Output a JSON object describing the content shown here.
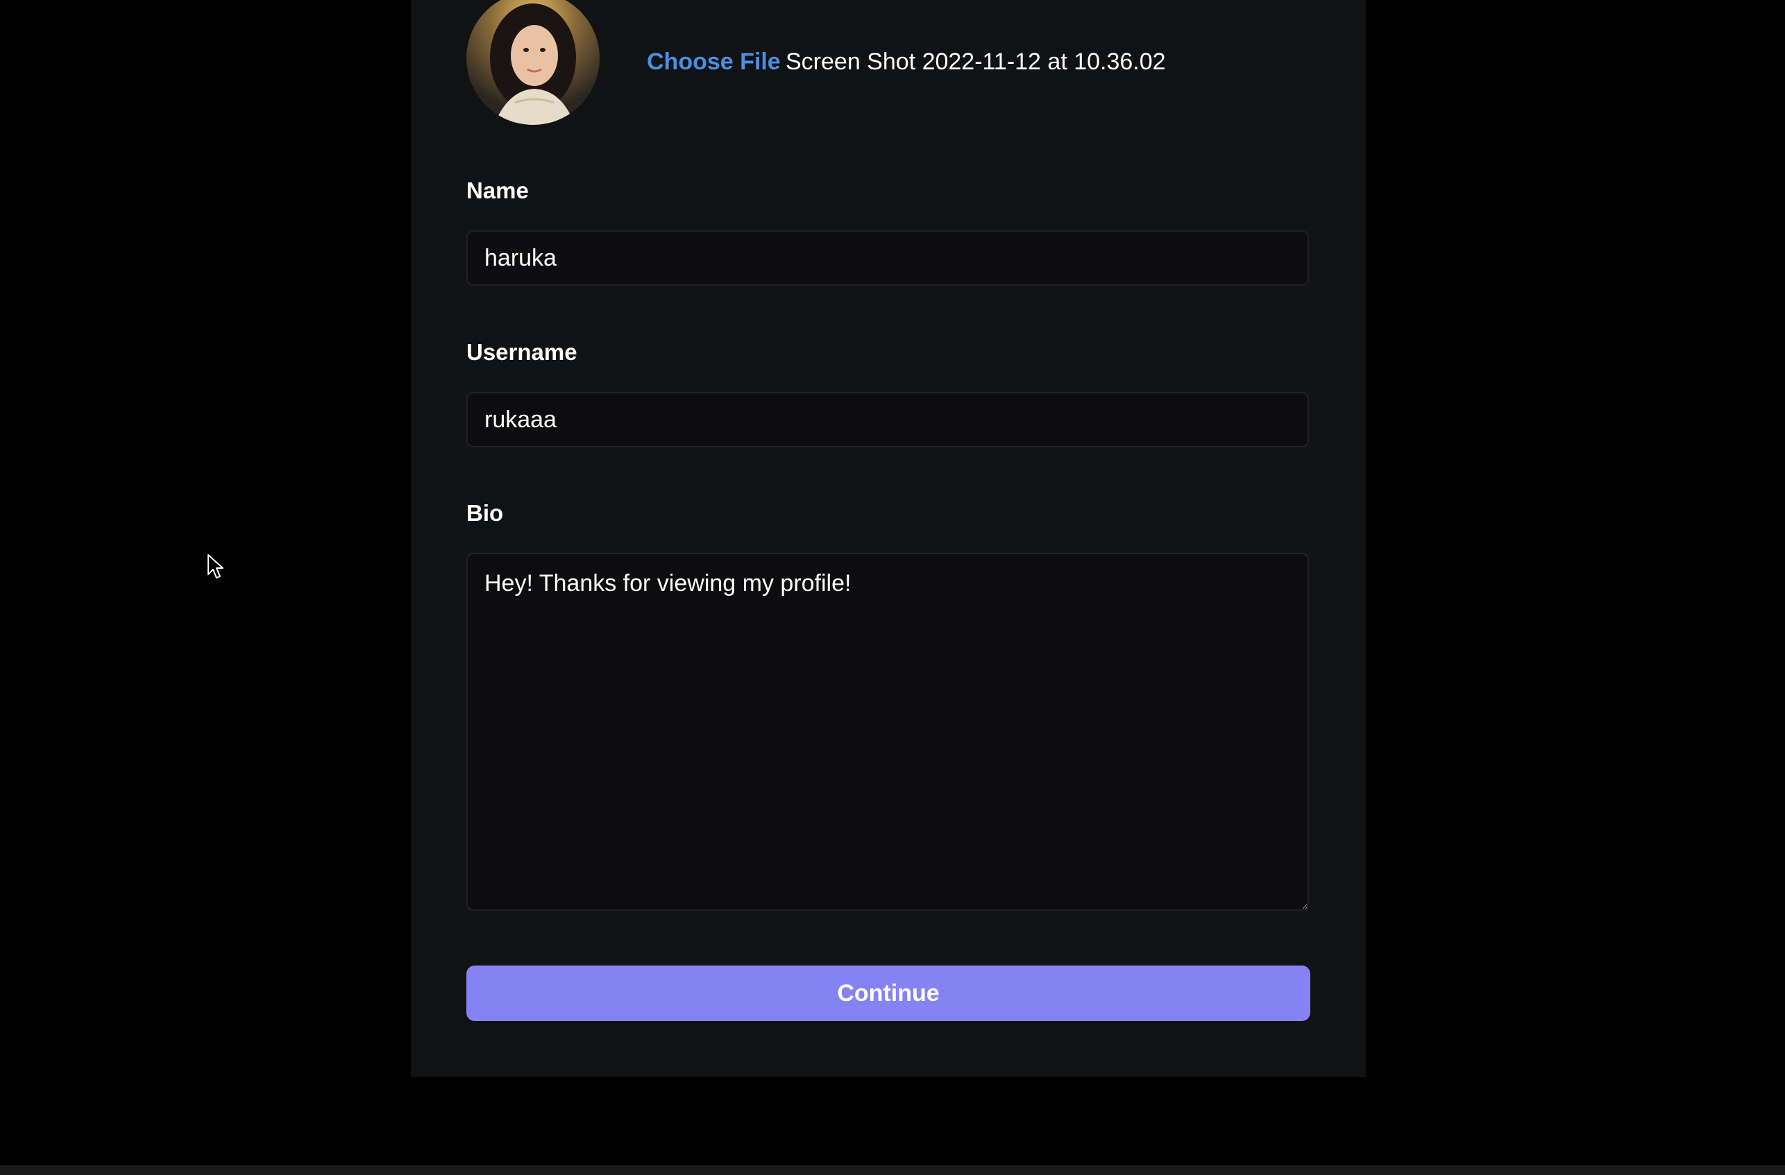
{
  "profile": {
    "choose_file_label": "Choose File",
    "file_name": "Screen Shot 2022-11-12 at 10.36.02"
  },
  "form": {
    "name_label": "Name",
    "name_value": "haruka",
    "username_label": "Username",
    "username_value": "rukaaa",
    "bio_label": "Bio",
    "bio_value": "Hey! Thanks for viewing my profile!",
    "continue_label": "Continue"
  },
  "colors": {
    "page_background": "#000000",
    "panel_background": "#111214",
    "accent_link": "#4a90e2",
    "button": "#8583f4"
  },
  "icons": [
    "mouse-cursor-icon"
  ]
}
